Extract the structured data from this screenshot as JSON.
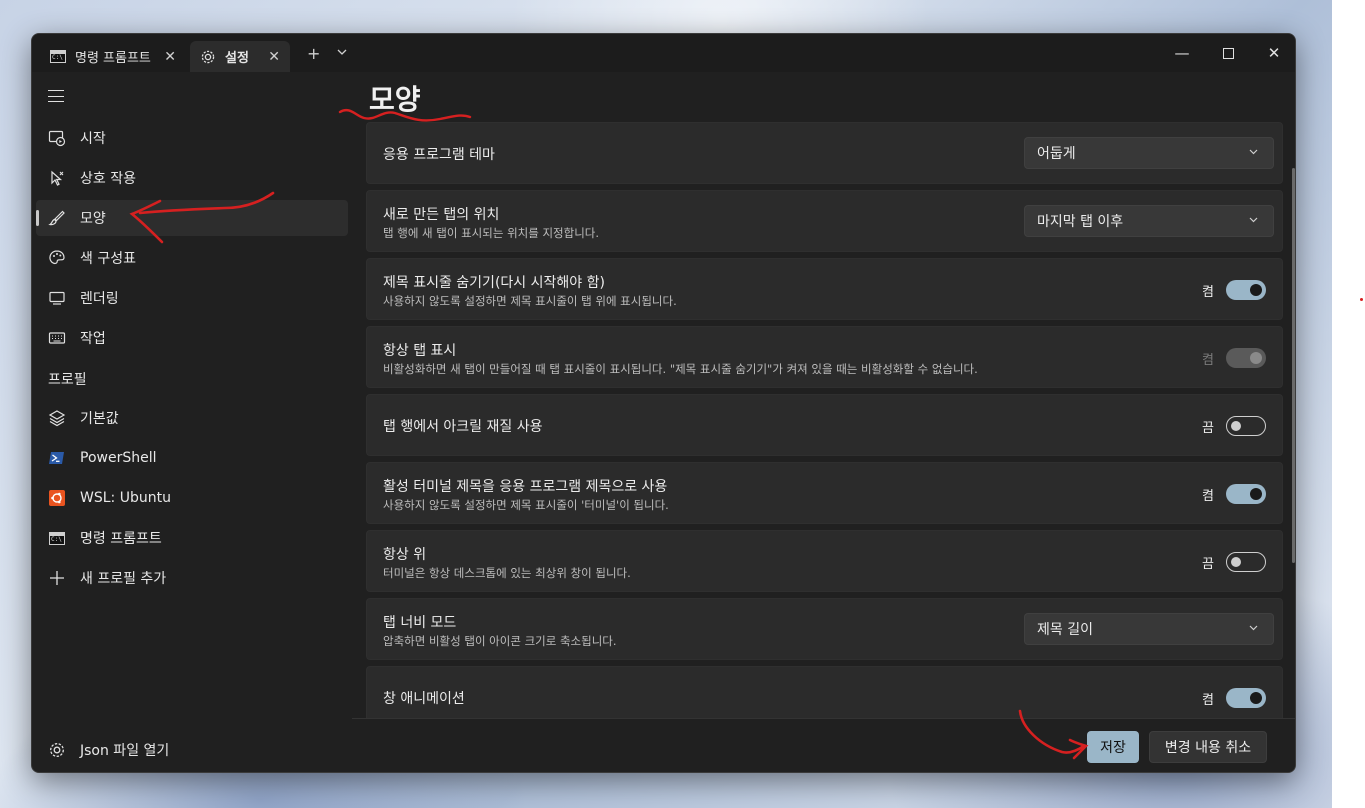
{
  "titlebar": {
    "tabs": [
      {
        "label": "명령 프롬프트",
        "icon": "command-prompt-icon",
        "active": false
      },
      {
        "label": "설정",
        "icon": "gear-icon",
        "active": true
      }
    ],
    "new_tab": "+",
    "dropdown": "⌄",
    "window_controls": {
      "minimize": "—",
      "maximize": "☐",
      "close": "✕"
    }
  },
  "sidebar": {
    "items": [
      {
        "label": "시작",
        "icon": "startup-icon"
      },
      {
        "label": "상호 작용",
        "icon": "interaction-icon"
      },
      {
        "label": "모양",
        "icon": "brush-icon",
        "selected": true
      },
      {
        "label": "색 구성표",
        "icon": "palette-icon"
      },
      {
        "label": "렌더링",
        "icon": "monitor-icon"
      },
      {
        "label": "작업",
        "icon": "keyboard-icon"
      }
    ],
    "profiles_header": "프로필",
    "profiles": [
      {
        "label": "기본값",
        "icon": "layers-icon"
      },
      {
        "label": "PowerShell",
        "icon": "powershell-icon"
      },
      {
        "label": "WSL: Ubuntu",
        "icon": "ubuntu-icon"
      },
      {
        "label": "명령 프롬프트",
        "icon": "command-prompt-icon"
      },
      {
        "label": "새 프로필 추가",
        "icon": "plus-icon"
      }
    ],
    "open_json": {
      "label": "Json 파일 열기",
      "icon": "gear-icon"
    }
  },
  "main": {
    "title": "모양",
    "settings": [
      {
        "title": "응용 프로그램 테마",
        "desc": "",
        "control": "dropdown",
        "value": "어둡게"
      },
      {
        "title": "새로 만든 탭의 위치",
        "desc": "탭 행에 새 탭이 표시되는 위치를 지정합니다.",
        "control": "dropdown",
        "value": "마지막 탭 이후"
      },
      {
        "title": "제목 표시줄 숨기기(다시 시작해야 함)",
        "desc": "사용하지 않도록 설정하면 제목 표시줄이 탭 위에 표시됩니다.",
        "control": "toggle",
        "state": "on",
        "value": "켬"
      },
      {
        "title": "항상 탭 표시",
        "desc": "비활성화하면 새 탭이 만들어질 때 탭 표시줄이 표시됩니다. \"제목 표시줄 숨기기\"가 켜져 있을 때는 비활성화할 수 없습니다.",
        "control": "toggle",
        "state": "disabled",
        "value": "켬"
      },
      {
        "title": "탭 행에서 아크릴 재질 사용",
        "desc": "",
        "control": "toggle",
        "state": "off",
        "value": "끔"
      },
      {
        "title": "활성 터미널 제목을 응용 프로그램 제목으로 사용",
        "desc": "사용하지 않도록 설정하면 제목 표시줄이 '터미널'이 됩니다.",
        "control": "toggle",
        "state": "on",
        "value": "켬"
      },
      {
        "title": "항상 위",
        "desc": "터미널은 항상 데스크톱에 있는 최상위 창이 됩니다.",
        "control": "toggle",
        "state": "off",
        "value": "끔"
      },
      {
        "title": "탭 너비 모드",
        "desc": "압축하면 비활성 탭이 아이콘 크기로 축소됩니다.",
        "control": "dropdown",
        "value": "제목 길이"
      },
      {
        "title": "창 애니메이션",
        "desc": "",
        "control": "toggle",
        "state": "on",
        "value": "켬"
      }
    ]
  },
  "footer": {
    "save": "저장",
    "discard": "변경 내용 취소"
  },
  "colors": {
    "accent": "#9ab6c8",
    "window_bg": "#202020",
    "card_bg": "#2b2b2b",
    "annotation_red": "#d62020"
  }
}
